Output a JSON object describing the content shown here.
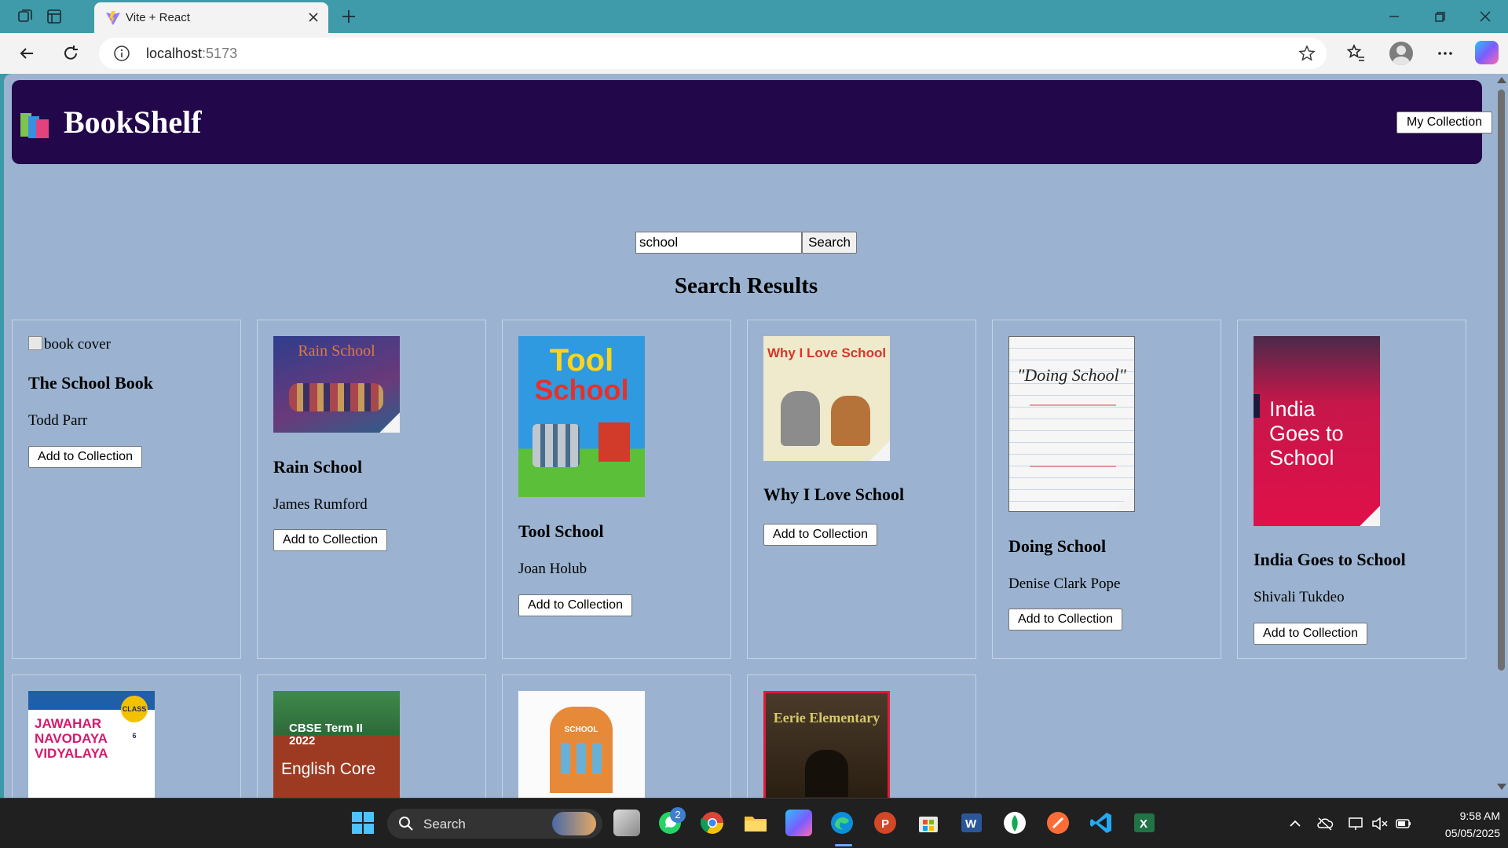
{
  "browser": {
    "tab_title": "Vite + React",
    "url_host": "localhost",
    "url_port": ":5173"
  },
  "app": {
    "brand": "BookShelf",
    "my_collection_label": "My Collection",
    "search_value": "school",
    "search_button_label": "Search",
    "results_title": "Search Results",
    "broken_cover_alt": "book cover",
    "add_button_label": "Add to Collection"
  },
  "books": [
    {
      "title": "The School Book",
      "author": "Todd Parr",
      "cover": "missing"
    },
    {
      "title": "Rain School",
      "author": "James Rumford",
      "cover_text": "Rain School",
      "cover_color": "#3a3f8a"
    },
    {
      "title": "Tool School",
      "author": "Joan Holub",
      "cover_text_1": "Tool",
      "cover_text_2": "School",
      "cover_color": "#2f9ae0"
    },
    {
      "title": "Why I Love School",
      "author": "",
      "cover_text": "Why I Love School",
      "cover_color": "#f1eed6"
    },
    {
      "title": "Doing School",
      "author": "Denise Clark Pope",
      "cover_text": "\"Doing School\"",
      "cover_color": "#f5f5f5"
    },
    {
      "title": "India Goes to School",
      "author": "Shivali Tukdeo",
      "cover_text": "India Goes to School",
      "cover_color": "#c6174a"
    }
  ],
  "books_row2": [
    {
      "cover_text": "JAWAHAR NAVODAYA VIDYALAYA",
      "badge": "CLASS 6",
      "cover_color": "#ffffff"
    },
    {
      "cover_text_1": "CBSE Term II 2022",
      "cover_text_2": "English Core",
      "cover_color": "#9c3a22"
    },
    {
      "cover_text": "SCHOOL",
      "cover_color": "#fbfbfb"
    },
    {
      "cover_text": "Eerie Elementary",
      "cover_color": "#2a1f12"
    }
  ],
  "taskbar": {
    "search_label": "Search",
    "whatsapp_badge": "2",
    "time": "9:58 AM",
    "date": "05/05/2025"
  },
  "colors": {
    "page_bg": "#9bb3d0",
    "header_bg": "#22074a",
    "browser_frame": "#3f9aa9"
  }
}
